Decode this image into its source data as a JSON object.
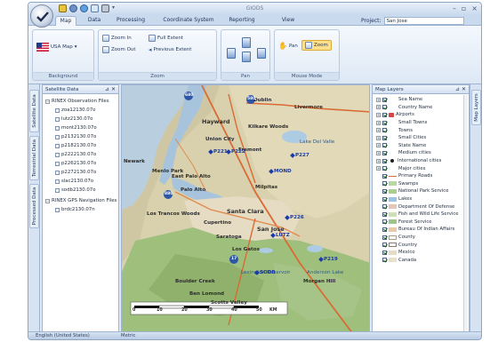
{
  "window": {
    "title": "GIODS"
  },
  "tabs": [
    "Map",
    "Data",
    "Processing",
    "Coordinate System",
    "Reporting",
    "View"
  ],
  "project": {
    "label": "Project:",
    "value": "San Jose"
  },
  "ribbon": {
    "background": {
      "label": "Background",
      "usa_map": "USA Map"
    },
    "zoom": {
      "label": "Zoom",
      "zoom_in": "Zoom In",
      "zoom_out": "Zoom Out",
      "full_extent": "Full Extent",
      "previous_extent": "Previous Extent"
    },
    "pan": {
      "label": "Pan"
    },
    "mouse_mode": {
      "label": "Mouse Mode",
      "pan": "Pan",
      "zoom": "Zoom"
    }
  },
  "side_tabs": {
    "satellite": "Satellite Data",
    "terrestrial": "Terrestrial Data",
    "processed": "Processed Data",
    "map_layers": "Map Layers"
  },
  "satellite_panel": {
    "title": "Satellite Data",
    "rinex_obs": "RINEX Observation Files",
    "obs_files": [
      "zoa12130.07o",
      "lutz2130.07o",
      "mont2130.07o",
      "p2132130.07o",
      "p2182130.07o",
      "p2222130.07o",
      "p2262130.07o",
      "p2272130.07o",
      "slac2130.07o",
      "sodb2130.07o"
    ],
    "rinex_nav": "RINEX GPS Navigation Files",
    "nav_files": [
      "brdc2130.07n"
    ]
  },
  "map": {
    "places": [
      "Dublin",
      "Livermore",
      "Hayward",
      "Kilkare Woods",
      "Union City",
      "Lake Del Valle",
      "Fremont",
      "Newark",
      "Menlo Park",
      "East Palo Alto",
      "Milpitas",
      "Palo Alto",
      "Santa Clara",
      "Los Trancos Woods",
      "Cupertino",
      "San Jose",
      "Saratoga",
      "Los Gatos",
      "Lexington Reservoir",
      "Anderson Lake",
      "Boulder Creek",
      "Morgan Hill",
      "Ben Lomond",
      "Scotts Valley"
    ],
    "sites": [
      "P221",
      "P222",
      "P227",
      "MOND",
      "P226",
      "LUTZ",
      "P219",
      "SODB"
    ],
    "highways": [
      "680",
      "580",
      "880",
      "17"
    ],
    "scale_ticks": [
      "0",
      "10",
      "20",
      "30",
      "40",
      "50"
    ],
    "scale_unit": "KM"
  },
  "layers_panel": {
    "title": "Map Layers",
    "layers": [
      "Sea Name",
      "Country Name",
      "Airports",
      "Small Towns",
      "Towns",
      "Small Cities",
      "State Name",
      "Medium cities",
      "International cities",
      "Major cities",
      "Primary Roads",
      "Swamps",
      "National Park Service",
      "Lakes",
      "Department Of Defense",
      "Fish and Wild Life Service",
      "Forest Service",
      "Bureau Of Indian Affairs",
      "County",
      "Country",
      "Mexico",
      "Canada"
    ]
  },
  "statusbar": {
    "language": "English (United States)",
    "metric": "Metric"
  }
}
